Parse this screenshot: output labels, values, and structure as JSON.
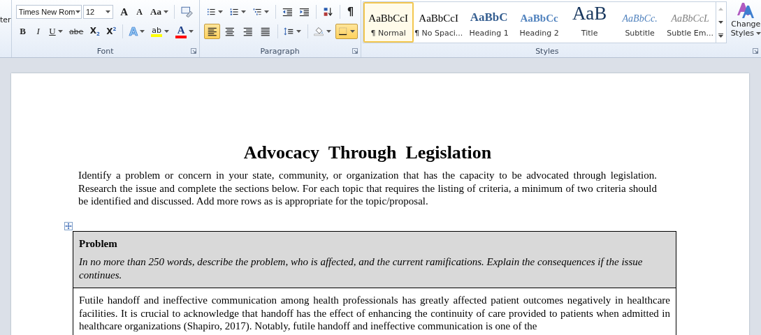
{
  "ribbon": {
    "clipboard_fragment": "ter",
    "font": {
      "label": "Font",
      "font_name": "Times New Rom",
      "font_size": "12",
      "row1": [
        {
          "kind": "grow",
          "text": "A"
        },
        {
          "kind": "shrink",
          "text": "A"
        },
        {
          "kind": "case",
          "text": "Aa"
        },
        {
          "kind": "clear"
        }
      ],
      "row2": [
        {
          "kind": "bold",
          "text": "B"
        },
        {
          "kind": "italic",
          "text": "I"
        },
        {
          "kind": "underline",
          "text": "U"
        },
        {
          "kind": "strike",
          "text": "abe"
        },
        {
          "kind": "subscript",
          "text": "X$_{2}$"
        },
        {
          "kind": "superscript",
          "text": "X$^{2}$"
        },
        {
          "kind": "effects",
          "text": "A"
        },
        {
          "kind": "highlight",
          "text": "ab"
        },
        {
          "kind": "color",
          "text": "A"
        }
      ]
    },
    "paragraph": {
      "label": "Paragraph",
      "row1": [
        {
          "kind": "bullets",
          "on": false
        },
        {
          "kind": "numbering",
          "on": false
        },
        {
          "kind": "multilevel",
          "on": false
        },
        {
          "kind": "outdent",
          "on": false
        },
        {
          "kind": "indent",
          "on": false
        },
        {
          "kind": "sort",
          "on": false
        },
        {
          "kind": "marks",
          "text": "¶",
          "on": false
        }
      ],
      "row2": [
        {
          "kind": "align-left",
          "on": true
        },
        {
          "kind": "align-center",
          "on": false
        },
        {
          "kind": "align-right",
          "on": false
        },
        {
          "kind": "justify",
          "on": false
        },
        {
          "kind": "spacing",
          "on": false
        },
        {
          "kind": "shading",
          "on": false
        },
        {
          "kind": "borders",
          "on": true
        }
      ]
    },
    "styles": {
      "label": "Styles",
      "items": [
        {
          "kind": "normal",
          "sample": "AaBbCcI",
          "name": "¶ Normal",
          "selected": true
        },
        {
          "kind": "no-spacing",
          "sample": "AaBbCcI",
          "name": "¶ No Spaci...",
          "selected": false
        },
        {
          "kind": "heading1",
          "sample": "AaBbC",
          "name": "Heading 1",
          "selected": false
        },
        {
          "kind": "heading2",
          "sample": "AaBbCc",
          "name": "Heading 2",
          "selected": false
        },
        {
          "kind": "title",
          "sample": "AaB",
          "name": "Title",
          "selected": false
        },
        {
          "kind": "subtitle",
          "sample": "AaBbCc.",
          "name": "Subtitle",
          "selected": false
        },
        {
          "kind": "subtle",
          "sample": "AaBbCcL",
          "name": "Subtle Em...",
          "selected": false
        }
      ],
      "change_styles": [
        "Change",
        "Styles"
      ]
    }
  },
  "document": {
    "title": "Advocacy  Through  Legislation",
    "intro": "Identify a problem or concern in your state, community, or organization that has the capacity to be advocated through legislation. Research the issue and complete the sections below. For each topic that requires the listing of criteria, a minimum of two criteria should be identified and discussed. Add more rows as is appropriate for the topic/proposal.",
    "table": [
      {
        "kind": "header",
        "heading": "Problem",
        "instructions": "In no more than 250 words, describe the problem, who is affected, and the current ramifications. Explain the consequences if the issue continues."
      },
      {
        "kind": "answer",
        "text": "Futile handoff and ineffective communication among health professionals has greatly affected patient outcomes negatively in healthcare facilities. It is crucial to acknowledge that handoff has the effect of enhancing the continuity of care provided to patients when admitted in healthcare organizations (Shapiro, 2017). Notably, futile handoff and ineffective communication is one of the"
      }
    ]
  }
}
